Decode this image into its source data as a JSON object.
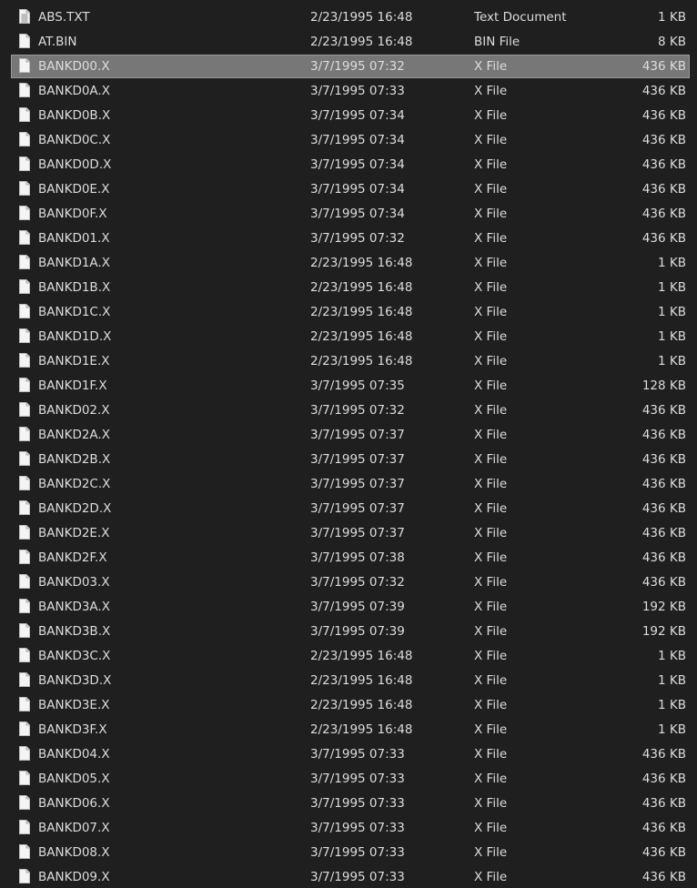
{
  "files": [
    {
      "name": "ABS.TXT",
      "date": "2/23/1995 16:48",
      "type": "Text Document",
      "size": "1 KB",
      "icon": "text-document-icon"
    },
    {
      "name": "AT.BIN",
      "date": "2/23/1995 16:48",
      "type": "BIN File",
      "size": "8 KB",
      "icon": "file-icon"
    },
    {
      "name": "BANKD00.X",
      "date": "3/7/1995 07:32",
      "type": "X File",
      "size": "436 KB",
      "icon": "file-icon",
      "selected": true
    },
    {
      "name": "BANKD0A.X",
      "date": "3/7/1995 07:33",
      "type": "X File",
      "size": "436 KB",
      "icon": "file-icon"
    },
    {
      "name": "BANKD0B.X",
      "date": "3/7/1995 07:34",
      "type": "X File",
      "size": "436 KB",
      "icon": "file-icon"
    },
    {
      "name": "BANKD0C.X",
      "date": "3/7/1995 07:34",
      "type": "X File",
      "size": "436 KB",
      "icon": "file-icon"
    },
    {
      "name": "BANKD0D.X",
      "date": "3/7/1995 07:34",
      "type": "X File",
      "size": "436 KB",
      "icon": "file-icon"
    },
    {
      "name": "BANKD0E.X",
      "date": "3/7/1995 07:34",
      "type": "X File",
      "size": "436 KB",
      "icon": "file-icon"
    },
    {
      "name": "BANKD0F.X",
      "date": "3/7/1995 07:34",
      "type": "X File",
      "size": "436 KB",
      "icon": "file-icon"
    },
    {
      "name": "BANKD01.X",
      "date": "3/7/1995 07:32",
      "type": "X File",
      "size": "436 KB",
      "icon": "file-icon"
    },
    {
      "name": "BANKD1A.X",
      "date": "2/23/1995 16:48",
      "type": "X File",
      "size": "1 KB",
      "icon": "file-icon"
    },
    {
      "name": "BANKD1B.X",
      "date": "2/23/1995 16:48",
      "type": "X File",
      "size": "1 KB",
      "icon": "file-icon"
    },
    {
      "name": "BANKD1C.X",
      "date": "2/23/1995 16:48",
      "type": "X File",
      "size": "1 KB",
      "icon": "file-icon"
    },
    {
      "name": "BANKD1D.X",
      "date": "2/23/1995 16:48",
      "type": "X File",
      "size": "1 KB",
      "icon": "file-icon"
    },
    {
      "name": "BANKD1E.X",
      "date": "2/23/1995 16:48",
      "type": "X File",
      "size": "1 KB",
      "icon": "file-icon"
    },
    {
      "name": "BANKD1F.X",
      "date": "3/7/1995 07:35",
      "type": "X File",
      "size": "128 KB",
      "icon": "file-icon"
    },
    {
      "name": "BANKD02.X",
      "date": "3/7/1995 07:32",
      "type": "X File",
      "size": "436 KB",
      "icon": "file-icon"
    },
    {
      "name": "BANKD2A.X",
      "date": "3/7/1995 07:37",
      "type": "X File",
      "size": "436 KB",
      "icon": "file-icon"
    },
    {
      "name": "BANKD2B.X",
      "date": "3/7/1995 07:37",
      "type": "X File",
      "size": "436 KB",
      "icon": "file-icon"
    },
    {
      "name": "BANKD2C.X",
      "date": "3/7/1995 07:37",
      "type": "X File",
      "size": "436 KB",
      "icon": "file-icon"
    },
    {
      "name": "BANKD2D.X",
      "date": "3/7/1995 07:37",
      "type": "X File",
      "size": "436 KB",
      "icon": "file-icon"
    },
    {
      "name": "BANKD2E.X",
      "date": "3/7/1995 07:37",
      "type": "X File",
      "size": "436 KB",
      "icon": "file-icon"
    },
    {
      "name": "BANKD2F.X",
      "date": "3/7/1995 07:38",
      "type": "X File",
      "size": "436 KB",
      "icon": "file-icon"
    },
    {
      "name": "BANKD03.X",
      "date": "3/7/1995 07:32",
      "type": "X File",
      "size": "436 KB",
      "icon": "file-icon"
    },
    {
      "name": "BANKD3A.X",
      "date": "3/7/1995 07:39",
      "type": "X File",
      "size": "192 KB",
      "icon": "file-icon"
    },
    {
      "name": "BANKD3B.X",
      "date": "3/7/1995 07:39",
      "type": "X File",
      "size": "192 KB",
      "icon": "file-icon"
    },
    {
      "name": "BANKD3C.X",
      "date": "2/23/1995 16:48",
      "type": "X File",
      "size": "1 KB",
      "icon": "file-icon"
    },
    {
      "name": "BANKD3D.X",
      "date": "2/23/1995 16:48",
      "type": "X File",
      "size": "1 KB",
      "icon": "file-icon"
    },
    {
      "name": "BANKD3E.X",
      "date": "2/23/1995 16:48",
      "type": "X File",
      "size": "1 KB",
      "icon": "file-icon"
    },
    {
      "name": "BANKD3F.X",
      "date": "2/23/1995 16:48",
      "type": "X File",
      "size": "1 KB",
      "icon": "file-icon"
    },
    {
      "name": "BANKD04.X",
      "date": "3/7/1995 07:33",
      "type": "X File",
      "size": "436 KB",
      "icon": "file-icon"
    },
    {
      "name": "BANKD05.X",
      "date": "3/7/1995 07:33",
      "type": "X File",
      "size": "436 KB",
      "icon": "file-icon"
    },
    {
      "name": "BANKD06.X",
      "date": "3/7/1995 07:33",
      "type": "X File",
      "size": "436 KB",
      "icon": "file-icon"
    },
    {
      "name": "BANKD07.X",
      "date": "3/7/1995 07:33",
      "type": "X File",
      "size": "436 KB",
      "icon": "file-icon"
    },
    {
      "name": "BANKD08.X",
      "date": "3/7/1995 07:33",
      "type": "X File",
      "size": "436 KB",
      "icon": "file-icon"
    },
    {
      "name": "BANKD09.X",
      "date": "3/7/1995 07:33",
      "type": "X File",
      "size": "436 KB",
      "icon": "file-icon"
    }
  ],
  "colors": {
    "background": "#1f1f1f",
    "text": "#dcdcdc",
    "selected_row": "#777777"
  }
}
